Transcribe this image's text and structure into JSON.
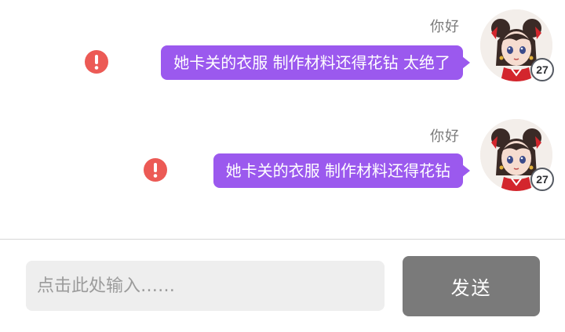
{
  "chat": {
    "messages": [
      {
        "sender_name": "你好",
        "text": "她卡关的衣服 制作材料还得花钻 太绝了",
        "status": "failed",
        "level": "27",
        "avatar": "girl-red-hair-ribbons-avatar"
      },
      {
        "sender_name": "你好",
        "text": "她卡关的衣服 制作材料还得花钻",
        "status": "failed",
        "level": "27",
        "avatar": "girl-red-hair-ribbons-avatar"
      }
    ]
  },
  "composer": {
    "placeholder": "点击此处输入……",
    "send_label": "发送"
  },
  "colors": {
    "bubble": "#9b59ee",
    "error": "#ec5a55",
    "send_button": "#7a7a7a",
    "input_bg": "#eeeeee"
  }
}
